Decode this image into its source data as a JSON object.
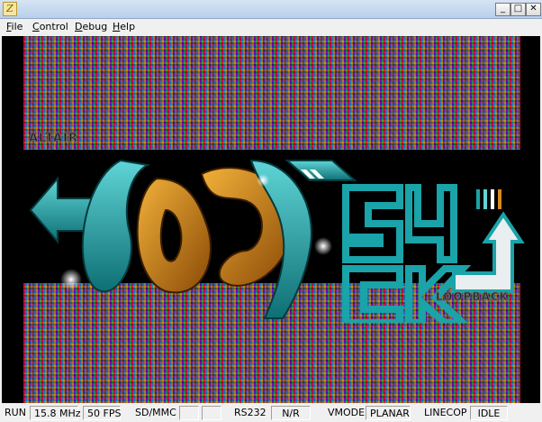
{
  "window": {
    "title": "",
    "app_icon_glyph": "Z",
    "controls": {
      "minimize": "_",
      "maximize": "□",
      "close": "✕"
    }
  },
  "menu": {
    "items": [
      {
        "label": "File",
        "accel": "F",
        "rest": "ile"
      },
      {
        "label": "Control",
        "accel": "C",
        "rest": "ontrol"
      },
      {
        "label": "Debug",
        "accel": "D",
        "rest": "ebug"
      },
      {
        "label": "Help",
        "accel": "H",
        "rest": "elp"
      }
    ]
  },
  "screen": {
    "text_top_left": "ALTAIR",
    "text_bottom_right": "LOOPBACK",
    "colors": {
      "teal": "#1aa3a8",
      "orange": "#d88a1c",
      "black": "#000000"
    }
  },
  "status": {
    "run": "RUN",
    "clock": "15.8 MHz",
    "fps": "50 FPS",
    "sdmmc_label": "SD/MMC",
    "sdmmc_val1": "",
    "sdmmc_val2": "",
    "rs232_label": "RS232",
    "rs232_val": "N/R",
    "vmode_label": "VMODE",
    "vmode_val": "PLANAR",
    "linecop_label": "LINECOP",
    "linecop_val": "IDLE"
  }
}
